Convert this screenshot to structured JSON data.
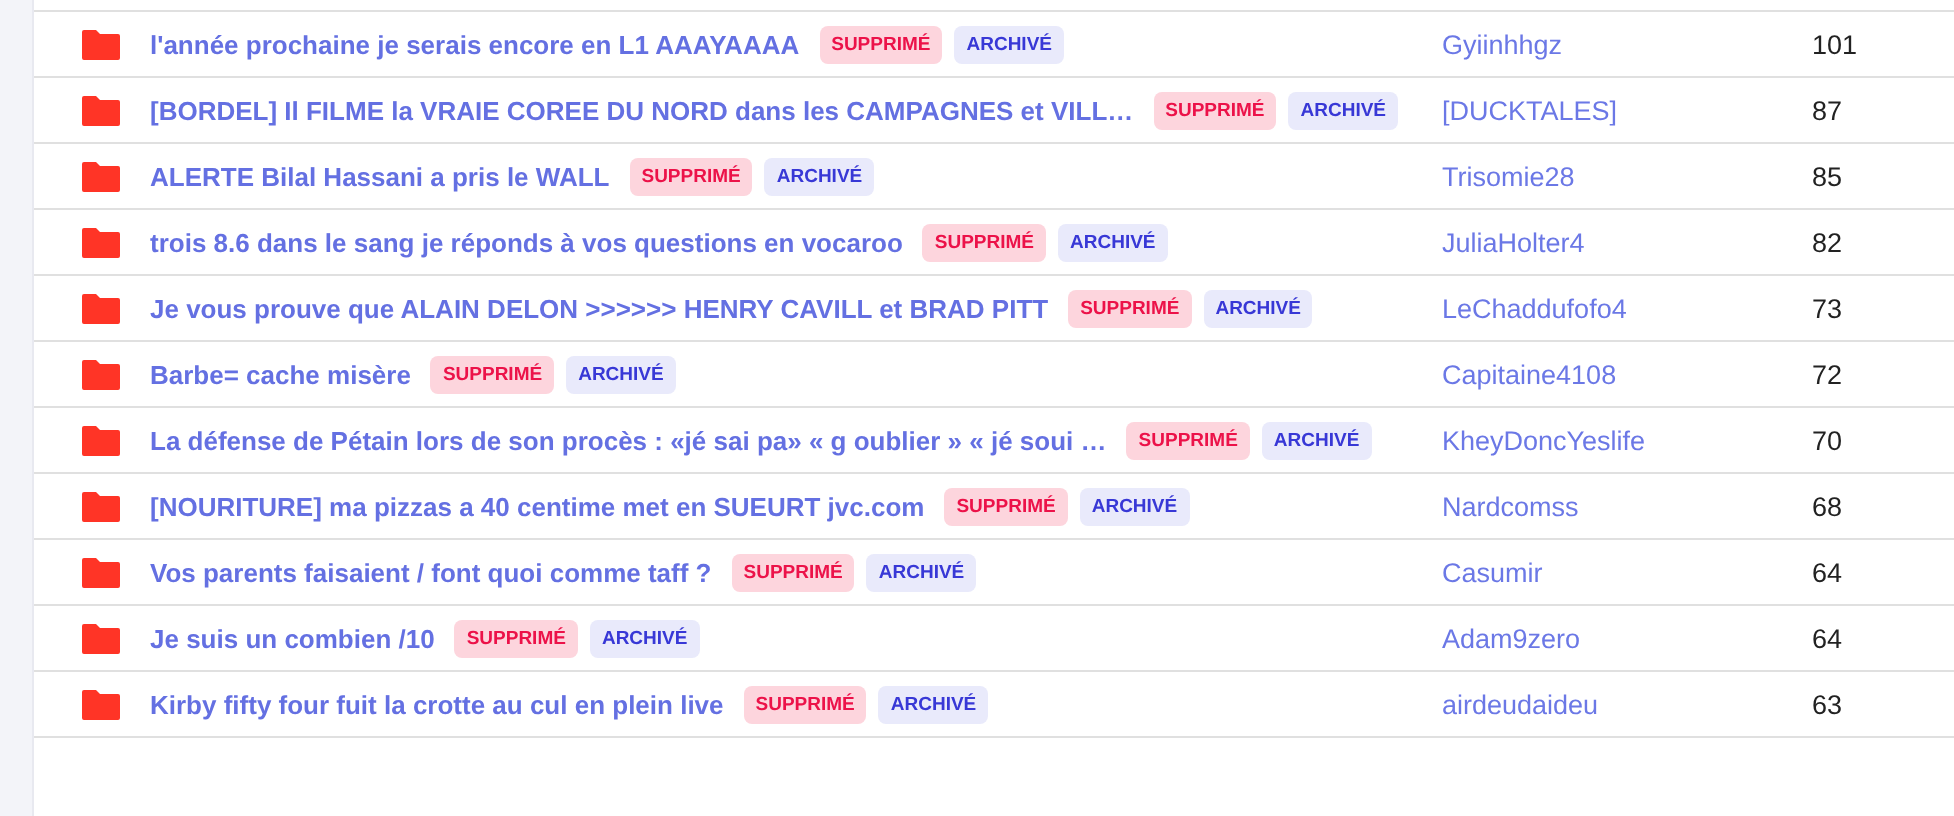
{
  "topics": [
    {
      "title": "l'année prochaine je serais encore en L1 AAAYAAAA",
      "badges": [
        {
          "label": "SUPPRIMÉ",
          "kind": "deleted"
        },
        {
          "label": "ARCHIVÉ",
          "kind": "archived"
        }
      ],
      "author": "Gyiinhhgz",
      "count": "101"
    },
    {
      "title": "[BORDEL] Il FILME la VRAIE COREE DU NORD dans les CAMPAGNES et VILL…",
      "badges": [
        {
          "label": "SUPPRIMÉ",
          "kind": "deleted"
        },
        {
          "label": "ARCHIVÉ",
          "kind": "archived"
        }
      ],
      "author": "[DUCKTALES]",
      "count": "87"
    },
    {
      "title": "ALERTE Bilal Hassani a pris le WALL",
      "badges": [
        {
          "label": "SUPPRIMÉ",
          "kind": "deleted"
        },
        {
          "label": "ARCHIVÉ",
          "kind": "archived"
        }
      ],
      "author": "Trisomie28",
      "count": "85"
    },
    {
      "title": "trois 8.6 dans le sang je réponds à vos questions en vocaroo",
      "badges": [
        {
          "label": "SUPPRIMÉ",
          "kind": "deleted"
        },
        {
          "label": "ARCHIVÉ",
          "kind": "archived"
        }
      ],
      "author": "JuliaHolter4",
      "count": "82"
    },
    {
      "title": "Je vous prouve que ALAIN DELON >>>>>> HENRY CAVILL et BRAD PITT",
      "badges": [
        {
          "label": "SUPPRIMÉ",
          "kind": "deleted"
        },
        {
          "label": "ARCHIVÉ",
          "kind": "archived"
        }
      ],
      "author": "LeChaddufofo4",
      "count": "73"
    },
    {
      "title": "Barbe= cache misère",
      "badges": [
        {
          "label": "SUPPRIMÉ",
          "kind": "deleted"
        },
        {
          "label": "ARCHIVÉ",
          "kind": "archived"
        }
      ],
      "author": "Capitaine4108",
      "count": "72"
    },
    {
      "title": "La défense de Pétain lors de son procès : «jé sai pa» « g oublier » « jé soui …",
      "badges": [
        {
          "label": "SUPPRIMÉ",
          "kind": "deleted"
        },
        {
          "label": "ARCHIVÉ",
          "kind": "archived"
        }
      ],
      "author": "KheyDoncYeslife",
      "count": "70"
    },
    {
      "title": "[NOURITURE] ma pizzas a 40 centime met en SUEURT jvc.com",
      "badges": [
        {
          "label": "SUPPRIMÉ",
          "kind": "deleted"
        },
        {
          "label": "ARCHIVÉ",
          "kind": "archived"
        }
      ],
      "author": "Nardcomss",
      "count": "68"
    },
    {
      "title": "Vos parents faisaient / font quoi comme taff ?",
      "badges": [
        {
          "label": "SUPPRIMÉ",
          "kind": "deleted"
        },
        {
          "label": "ARCHIVÉ",
          "kind": "archived"
        }
      ],
      "author": "Casumir",
      "count": "64"
    },
    {
      "title": "Je suis un combien /10",
      "badges": [
        {
          "label": "SUPPRIMÉ",
          "kind": "deleted"
        },
        {
          "label": "ARCHIVÉ",
          "kind": "archived"
        }
      ],
      "author": "Adam9zero",
      "count": "64"
    },
    {
      "title": "Kirby fifty four fuit la crotte au cul en plein live",
      "badges": [
        {
          "label": "SUPPRIMÉ",
          "kind": "deleted"
        },
        {
          "label": "ARCHIVÉ",
          "kind": "archived"
        }
      ],
      "author": "airdeudaideu",
      "count": "63"
    }
  ]
}
